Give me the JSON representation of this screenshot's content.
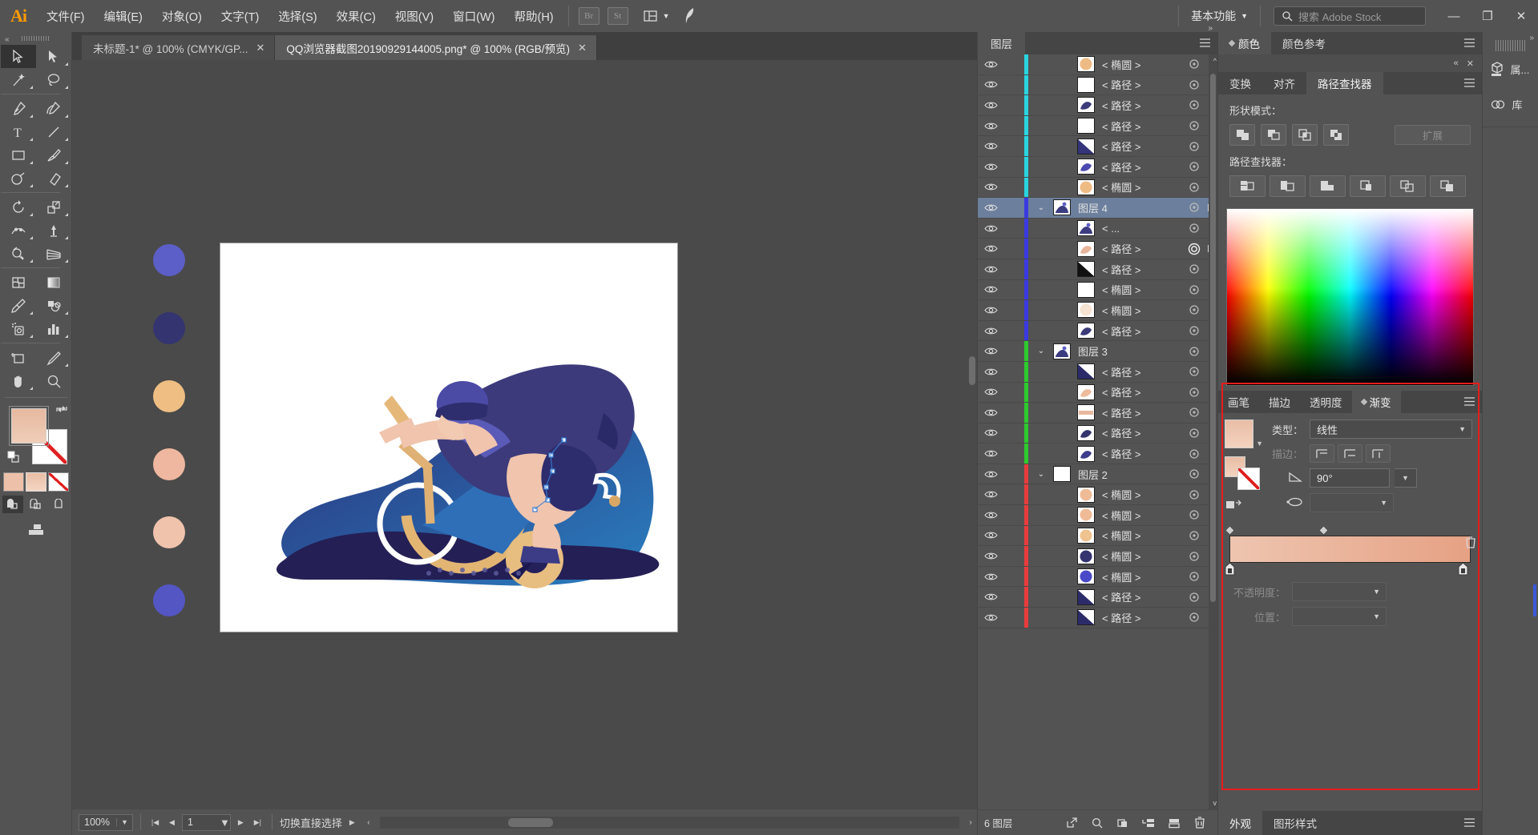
{
  "app": {
    "logo": "Ai"
  },
  "menubar": {
    "items": [
      "文件(F)",
      "编辑(E)",
      "对象(O)",
      "文字(T)",
      "选择(S)",
      "效果(C)",
      "视图(V)",
      "窗口(W)",
      "帮助(H)"
    ],
    "bridge_label": "Br",
    "stock_label": "St",
    "workspace": "基本功能",
    "search_placeholder": "搜索 Adobe Stock",
    "window_min": "—",
    "window_restore": "❐",
    "window_close": "✕"
  },
  "tabs": [
    {
      "title": "未标题-1* @ 100% (CMYK/GP...",
      "close": "✕",
      "active": false
    },
    {
      "title": "QQ浏览器截图20190929144005.png* @ 100% (RGB/预览)",
      "close": "✕",
      "active": true
    }
  ],
  "toolbar": {
    "tools": [
      {
        "name": "selection-tool",
        "sel": true
      },
      {
        "name": "direct-selection-tool",
        "sel": false
      },
      {
        "name": "magic-wand-tool",
        "sel": false
      },
      {
        "name": "lasso-tool",
        "sel": false
      },
      {
        "name": "pen-tool",
        "sel": false
      },
      {
        "name": "curvature-tool",
        "sel": false
      },
      {
        "name": "type-tool",
        "sel": false
      },
      {
        "name": "line-segment-tool",
        "sel": false
      },
      {
        "name": "rectangle-tool",
        "sel": false
      },
      {
        "name": "paintbrush-tool",
        "sel": false
      },
      {
        "name": "shaper-tool",
        "sel": false
      },
      {
        "name": "eraser-tool",
        "sel": false
      },
      {
        "name": "rotate-tool",
        "sel": false
      },
      {
        "name": "scale-tool",
        "sel": false
      },
      {
        "name": "width-tool",
        "sel": false
      },
      {
        "name": "free-transform-tool",
        "sel": false
      },
      {
        "name": "shape-builder-tool",
        "sel": false
      },
      {
        "name": "perspective-grid-tool",
        "sel": false
      },
      {
        "name": "mesh-tool",
        "sel": false
      },
      {
        "name": "gradient-tool",
        "sel": false
      },
      {
        "name": "eyedropper-tool",
        "sel": false
      },
      {
        "name": "blend-tool",
        "sel": false
      },
      {
        "name": "symbol-sprayer-tool",
        "sel": false
      },
      {
        "name": "column-graph-tool",
        "sel": false
      },
      {
        "name": "artboard-tool",
        "sel": false
      },
      {
        "name": "slice-tool",
        "sel": false
      },
      {
        "name": "hand-tool",
        "sel": false
      },
      {
        "name": "zoom-tool",
        "sel": false
      }
    ],
    "fill_color": "#edc1a9",
    "stroke_color": "#ffffff",
    "none_marker": "none"
  },
  "canvas": {
    "swatches": [
      "#5c5fc7",
      "#343470",
      "#eebe83",
      "#efb79f",
      "#f0c3ad",
      "#5456c4"
    ],
    "artboard_bg": "#ffffff"
  },
  "statusbar": {
    "zoom": "100%",
    "first": "|◀",
    "prev": "◀",
    "page": "1",
    "next": "▶",
    "last": "▶|",
    "message": "切换直接选择",
    "play": "▶",
    "left_arrow": "‹",
    "right_arrow": "›"
  },
  "layers_panel": {
    "tab": "图层",
    "footer_count": "6 图层",
    "footer_buttons": [
      "locate-object",
      "make-clipping-mask",
      "create-new-sublayer",
      "create-new-layer",
      "delete-selection"
    ],
    "rows": [
      {
        "name": "< 椭圆 >",
        "depth": 2,
        "color": "#2ad4e0",
        "thumb": "#eebb85",
        "thumbtype": "ellipse",
        "sel": false,
        "expand": false,
        "target": false,
        "selsq": false
      },
      {
        "name": "< 路径 >",
        "depth": 2,
        "color": "#2ad4e0",
        "thumb": "#ffffff",
        "thumbtype": "blank",
        "sel": false,
        "expand": false,
        "target": false,
        "selsq": false
      },
      {
        "name": "< 路径 >",
        "depth": 2,
        "color": "#2ad4e0",
        "thumb": "#3b3b7a",
        "thumbtype": "shape",
        "sel": false,
        "expand": false,
        "target": false,
        "selsq": false
      },
      {
        "name": "< 路径 >",
        "depth": 2,
        "color": "#2ad4e0",
        "thumb": "#ffffff",
        "thumbtype": "blank",
        "sel": false,
        "expand": false,
        "target": false,
        "selsq": false
      },
      {
        "name": "< 路径 >",
        "depth": 2,
        "color": "#2ad4e0",
        "thumb": "#33337a",
        "thumbtype": "diag",
        "sel": false,
        "expand": false,
        "target": false,
        "selsq": false
      },
      {
        "name": "< 路径 >",
        "depth": 2,
        "color": "#2ad4e0",
        "thumb": "#4a4ab0",
        "thumbtype": "shape",
        "sel": false,
        "expand": false,
        "target": false,
        "selsq": false
      },
      {
        "name": "< 椭圆 >",
        "depth": 2,
        "color": "#2ad4e0",
        "thumb": "#eebb85",
        "thumbtype": "ellipse",
        "sel": false,
        "expand": false,
        "target": false,
        "selsq": false
      },
      {
        "name": "图层 4",
        "depth": 1,
        "color": "#3a3ae0",
        "thumb": "#8899cc",
        "thumbtype": "art",
        "sel": true,
        "expand": true,
        "target": false,
        "selsq": true
      },
      {
        "name": "< ...",
        "depth": 2,
        "color": "#3a3ae0",
        "thumb": "#9aa8cc",
        "thumbtype": "art",
        "sel": false,
        "expand": false,
        "target": false,
        "selsq": false
      },
      {
        "name": "< 路径 >",
        "depth": 2,
        "color": "#3a3ae0",
        "thumb": "#e8b49a",
        "thumbtype": "shape",
        "sel": false,
        "expand": false,
        "target": true,
        "selsq": true
      },
      {
        "name": "< 路径 >",
        "depth": 2,
        "color": "#3a3ae0",
        "thumb": "#111111",
        "thumbtype": "diag",
        "sel": false,
        "expand": false,
        "target": false,
        "selsq": false
      },
      {
        "name": "< 椭圆 >",
        "depth": 2,
        "color": "#3a3ae0",
        "thumb": "#ffffff",
        "thumbtype": "blank",
        "sel": false,
        "expand": false,
        "target": false,
        "selsq": false
      },
      {
        "name": "< 椭圆 >",
        "depth": 2,
        "color": "#3a3ae0",
        "thumb": "#f6e3d2",
        "thumbtype": "ellipse",
        "sel": false,
        "expand": false,
        "target": false,
        "selsq": false
      },
      {
        "name": "< 路径 >",
        "depth": 2,
        "color": "#3a3ae0",
        "thumb": "#3b3b7a",
        "thumbtype": "shape",
        "sel": false,
        "expand": false,
        "target": false,
        "selsq": false
      },
      {
        "name": "图层 3",
        "depth": 1,
        "color": "#2fc92f",
        "thumb": "#6a6ac0",
        "thumbtype": "art",
        "sel": false,
        "expand": true,
        "target": false,
        "selsq": false
      },
      {
        "name": "< 路径 >",
        "depth": 2,
        "color": "#2fc92f",
        "thumb": "#2b2b6a",
        "thumbtype": "diag",
        "sel": false,
        "expand": false,
        "target": false,
        "selsq": false
      },
      {
        "name": "< 路径 >",
        "depth": 2,
        "color": "#2fc92f",
        "thumb": "#edbb9c",
        "thumbtype": "shape",
        "sel": false,
        "expand": false,
        "target": false,
        "selsq": false
      },
      {
        "name": "< 路径 >",
        "depth": 2,
        "color": "#2fc92f",
        "thumb": "#e8b8a0",
        "thumbtype": "bar",
        "sel": false,
        "expand": false,
        "target": false,
        "selsq": false
      },
      {
        "name": "< 路径 >",
        "depth": 2,
        "color": "#2fc92f",
        "thumb": "#33336e",
        "thumbtype": "shape",
        "sel": false,
        "expand": false,
        "target": false,
        "selsq": false
      },
      {
        "name": "< 路径 >",
        "depth": 2,
        "color": "#2fc92f",
        "thumb": "#3d3d8c",
        "thumbtype": "shape",
        "sel": false,
        "expand": false,
        "target": false,
        "selsq": false
      },
      {
        "name": "图层 2",
        "depth": 1,
        "color": "#e83c3c",
        "thumb": "#ffffff",
        "thumbtype": "blank",
        "sel": false,
        "expand": true,
        "target": false,
        "selsq": false
      },
      {
        "name": "< 椭圆 >",
        "depth": 2,
        "color": "#e83c3c",
        "thumb": "#efbb97",
        "thumbtype": "ellipse",
        "sel": false,
        "expand": false,
        "target": false,
        "selsq": false
      },
      {
        "name": "< 椭圆 >",
        "depth": 2,
        "color": "#e83c3c",
        "thumb": "#efbb97",
        "thumbtype": "ellipse",
        "sel": false,
        "expand": false,
        "target": false,
        "selsq": false
      },
      {
        "name": "< 椭圆 >",
        "depth": 2,
        "color": "#e83c3c",
        "thumb": "#efc38f",
        "thumbtype": "ellipse",
        "sel": false,
        "expand": false,
        "target": false,
        "selsq": false
      },
      {
        "name": "< 椭圆 >",
        "depth": 2,
        "color": "#e83c3c",
        "thumb": "#343470",
        "thumbtype": "ellipse",
        "sel": false,
        "expand": false,
        "target": false,
        "selsq": false
      },
      {
        "name": "< 椭圆 >",
        "depth": 2,
        "color": "#e83c3c",
        "thumb": "#4a4ac8",
        "thumbtype": "ellipse",
        "sel": false,
        "expand": false,
        "target": false,
        "selsq": false
      },
      {
        "name": "< 路径 >",
        "depth": 2,
        "color": "#e83c3c",
        "thumb": "#2b2b6a",
        "thumbtype": "diag",
        "sel": false,
        "expand": false,
        "target": false,
        "selsq": false
      },
      {
        "name": "< 路径 >",
        "depth": 2,
        "color": "#e83c3c",
        "thumb": "#2b2b6a",
        "thumbtype": "diag",
        "sel": false,
        "expand": false,
        "target": false,
        "selsq": false
      }
    ]
  },
  "right_dock": {
    "color_tabs": [
      {
        "label": "颜色",
        "active": true,
        "has_diamond": true
      },
      {
        "label": "颜色参考",
        "active": false,
        "has_diamond": false
      }
    ],
    "collapse_icon": "«",
    "close_icon": "✕",
    "pathfinder_tabs": [
      {
        "label": "变换",
        "active": false
      },
      {
        "label": "对齐",
        "active": false
      },
      {
        "label": "路径查找器",
        "active": true
      }
    ],
    "shape_modes_label": "形状模式：",
    "expand_label": "扩展",
    "pathfinder_label": "路径查找器：",
    "shape_mode_buttons": [
      "unite",
      "minus-front",
      "intersect",
      "exclude"
    ],
    "pathfinder_buttons": [
      "divide",
      "trim",
      "merge",
      "crop",
      "outline",
      "minus-back"
    ]
  },
  "gradient_panel": {
    "tabs": [
      {
        "label": "画笔",
        "active": false,
        "has_diamond": false
      },
      {
        "label": "描边",
        "active": false,
        "has_diamond": false
      },
      {
        "label": "透明度",
        "active": false,
        "has_diamond": false
      },
      {
        "label": "渐变",
        "active": true,
        "has_diamond": true
      }
    ],
    "type_label": "类型：",
    "type_value": "线性",
    "stroke_label": "描边：",
    "angle_value": "90°",
    "opacity_label": "不透明度：",
    "position_label": "位置：",
    "gradient_start": "#efcbb8",
    "gradient_end": "#e39e80",
    "highlight_color": "#e81c1c"
  },
  "appearance_tabs": [
    {
      "label": "外观",
      "active": true
    },
    {
      "label": "图形样式",
      "active": false
    }
  ],
  "icon_dock": {
    "items": [
      {
        "label": "属...",
        "icon": "properties-icon"
      },
      {
        "label": "库",
        "icon": "libraries-icon"
      }
    ]
  }
}
